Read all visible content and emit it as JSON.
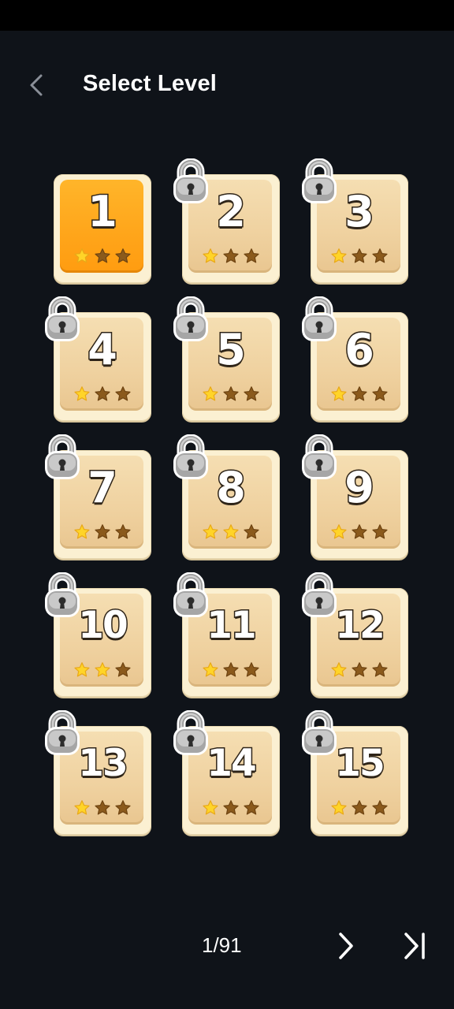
{
  "header": {
    "title": "Select Level",
    "back_icon": "chevron-left-icon"
  },
  "levels": [
    {
      "label": "1",
      "stars": 1,
      "locked": false,
      "active": true
    },
    {
      "label": "2",
      "stars": 1,
      "locked": true,
      "active": false
    },
    {
      "label": "3",
      "stars": 1,
      "locked": true,
      "active": false
    },
    {
      "label": "4",
      "stars": 1,
      "locked": true,
      "active": false
    },
    {
      "label": "5",
      "stars": 1,
      "locked": true,
      "active": false
    },
    {
      "label": "6",
      "stars": 1,
      "locked": true,
      "active": false
    },
    {
      "label": "7",
      "stars": 1,
      "locked": true,
      "active": false
    },
    {
      "label": "8",
      "stars": 2,
      "locked": true,
      "active": false
    },
    {
      "label": "9",
      "stars": 1,
      "locked": true,
      "active": false
    },
    {
      "label": "10",
      "stars": 2,
      "locked": true,
      "active": false
    },
    {
      "label": "11",
      "stars": 1,
      "locked": true,
      "active": false
    },
    {
      "label": "12",
      "stars": 1,
      "locked": true,
      "active": false
    },
    {
      "label": "13",
      "stars": 1,
      "locked": true,
      "active": false
    },
    {
      "label": "14",
      "stars": 1,
      "locked": true,
      "active": false
    },
    {
      "label": "15",
      "stars": 1,
      "locked": true,
      "active": false
    }
  ],
  "pagination": {
    "indicator": "1/91",
    "next_icon": "chevron-right-icon",
    "last_icon": "skip-to-end-icon"
  },
  "colors": {
    "background": "#0f1319",
    "card_bg": "#fbf0d2",
    "active_tile": "#ffa51a",
    "star_filled": "#ffd428",
    "star_empty": "#8b5a1c"
  }
}
